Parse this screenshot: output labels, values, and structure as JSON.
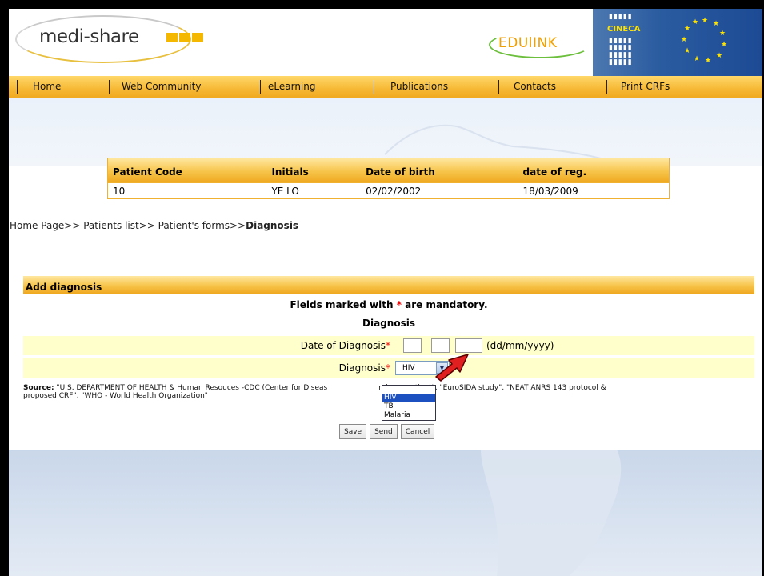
{
  "header": {
    "logo_text": "medi-share",
    "partner_logo_text": "EDUlINK",
    "cineca_text": "CINECA"
  },
  "nav": {
    "items": [
      "Home",
      "Web Community",
      "eLearning",
      "Publications",
      "Contacts",
      "Print CRFs"
    ]
  },
  "patient": {
    "headers": [
      "Patient Code",
      "Initials",
      "Date of birth",
      "date of reg."
    ],
    "row": [
      "10",
      "YE LO",
      "02/02/2002",
      "18/03/2009"
    ]
  },
  "breadcrumb": {
    "trail": "Home Page>> Patients list>> Patient's forms>>",
    "current": "Diagnosis"
  },
  "form": {
    "title": "Add diagnosis",
    "mandatory_prefix": "Fields marked with ",
    "mandatory_star": "*",
    "mandatory_suffix": " are mandatory.",
    "section_title": "Diagnosis",
    "date_label": "Date of Diagnosis",
    "date_format": "(dd/mm/yyyy)",
    "diagnosis_label": "Diagnosis",
    "required_mark": "*",
    "diagnosis_selected": "HIV",
    "diagnosis_options": [
      "HIV",
      "TB",
      "Malaria"
    ],
    "source_label": "Source:",
    "source_text": " \"U.S. DEPARTMENT OF HEALTH & Human Resouces -CDC (Center for Diseas",
    "source_text_tail": "nd prevention)\", \"EuroSIDA study\", \"NEAT ANRS 143 protocol &",
    "source_text2": "proposed CRF\", \"WHO - World Health Organization\""
  },
  "buttons": {
    "save": "Save",
    "send": "Send",
    "cancel": "Cancel"
  },
  "colors": {
    "accent_orange": "#f6b733",
    "form_row_bg": "#ffffcc",
    "required_red": "#e00000",
    "pointer_arrow": "#e02020"
  }
}
